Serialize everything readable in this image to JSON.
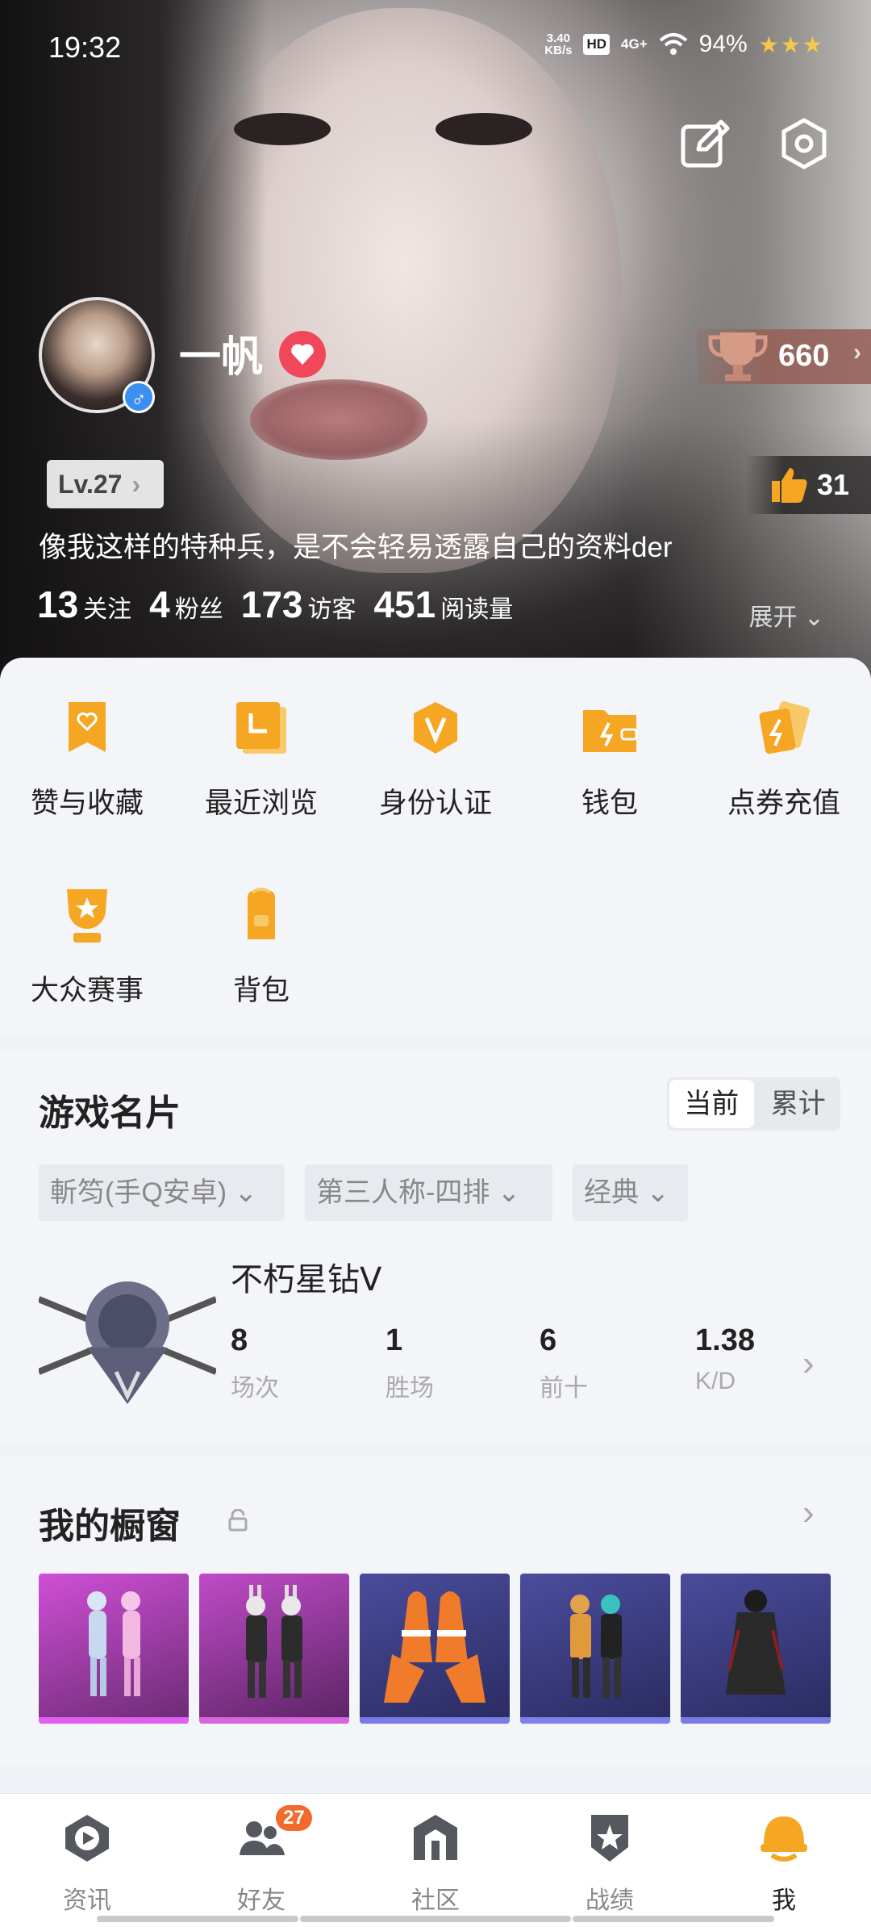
{
  "status_bar": {
    "time": "19:32",
    "net_speed_value": "3.40",
    "net_speed_unit": "KB/s",
    "hd": "HD",
    "signal": "4G+",
    "battery": "94%"
  },
  "profile": {
    "username": "一帆",
    "trophy_score": "660",
    "level": "Lv.27",
    "likes": "31",
    "bio": "像我这样的特种兵，是不会轻易透露自己的资料der",
    "stats": [
      {
        "value": "13",
        "label": "关注"
      },
      {
        "value": "4",
        "label": "粉丝"
      },
      {
        "value": "173",
        "label": "访客"
      },
      {
        "value": "451",
        "label": "阅读量"
      }
    ],
    "expand": "展开"
  },
  "features": [
    {
      "label": "赞与收藏",
      "icon": "heart-bookmark-icon"
    },
    {
      "label": "最近浏览",
      "icon": "recent-icon"
    },
    {
      "label": "身份认证",
      "icon": "verify-v-icon"
    },
    {
      "label": "钱包",
      "icon": "wallet-icon"
    },
    {
      "label": "点券充值",
      "icon": "coupon-card-icon"
    },
    {
      "label": "大众赛事",
      "icon": "trophy-cup-icon"
    },
    {
      "label": "背包",
      "icon": "backpack-icon"
    }
  ],
  "game_card": {
    "title": "游戏名片",
    "toggle": [
      "当前",
      "累计"
    ],
    "filters": [
      "斬笉(手Q安卓)",
      "第三人称-四排",
      "经典"
    ],
    "rank_name": "不朽星钻Ⅴ",
    "metrics": [
      {
        "value": "8",
        "label": "场次"
      },
      {
        "value": "1",
        "label": "胜场"
      },
      {
        "value": "6",
        "label": "前十"
      },
      {
        "value": "1.38",
        "label": "K/D"
      }
    ]
  },
  "showcase": {
    "title": "我的橱窗",
    "items": [
      {
        "name": "pink-outfit",
        "bg": "#b03fb6",
        "bar": "#e15ff0"
      },
      {
        "name": "bunny-suit",
        "bg": "#9d3aa6",
        "bar": "#d864e0"
      },
      {
        "name": "orange-suit",
        "bg": "#3d3f8a",
        "bar": "#7a7ae8"
      },
      {
        "name": "punk-outfit",
        "bg": "#3f418c",
        "bar": "#8080ea"
      },
      {
        "name": "dark-coat",
        "bg": "#3a3c86",
        "bar": "#7b7be6"
      }
    ]
  },
  "nav": [
    {
      "label": "资讯",
      "icon": "news-play-icon"
    },
    {
      "label": "好友",
      "icon": "friends-icon",
      "badge": "27"
    },
    {
      "label": "社区",
      "icon": "community-icon"
    },
    {
      "label": "战绩",
      "icon": "record-shield-icon"
    },
    {
      "label": "我",
      "icon": "me-helmet-icon"
    }
  ],
  "colors": {
    "accent": "#f5a623",
    "badge": "#f26b2c",
    "heart": "#f0475a"
  }
}
